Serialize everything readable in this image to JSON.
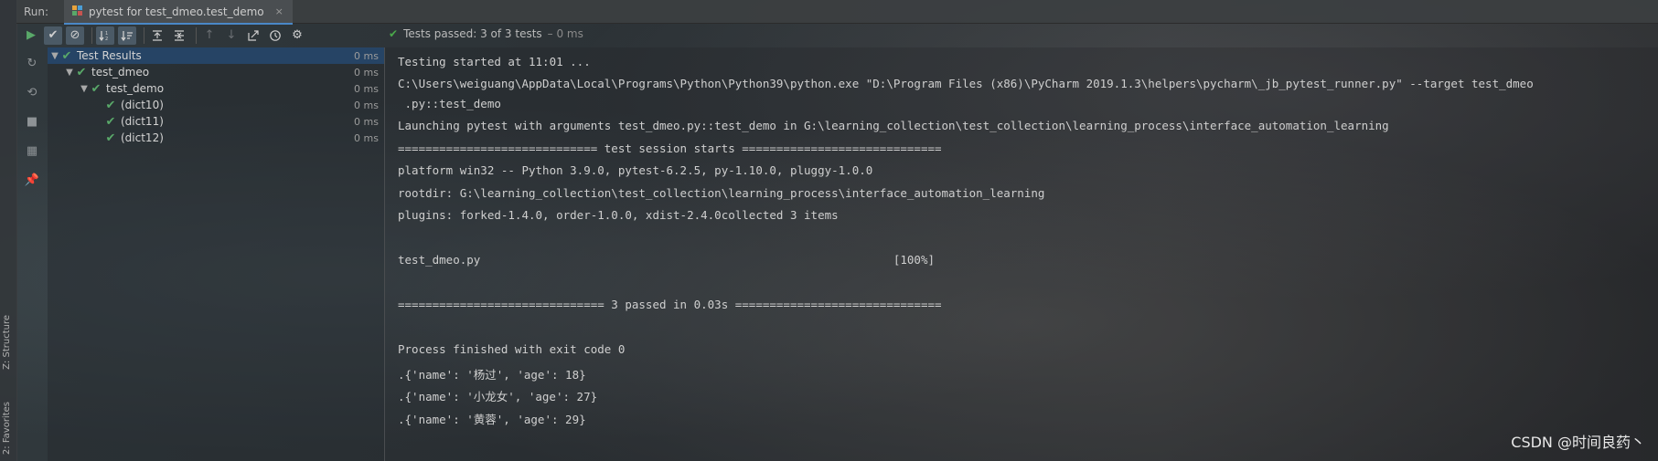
{
  "run_header": {
    "label": "Run:",
    "tab_title": "pytest for test_dmeo.test_demo",
    "tab_close": "×"
  },
  "status": {
    "text": "Tests passed: 3 of 3 tests",
    "duration": "– 0 ms"
  },
  "side_strip": {
    "structure_label": "Z: Structure",
    "favorites_label": "2: Favorites"
  },
  "tree": [
    {
      "label": "Test Results",
      "time": "0 ms",
      "level": 0
    },
    {
      "label": "test_dmeo",
      "time": "0 ms",
      "level": 1
    },
    {
      "label": "test_demo",
      "time": "0 ms",
      "level": 2
    },
    {
      "label": "(dict10)",
      "time": "0 ms",
      "level": 3
    },
    {
      "label": "(dict11)",
      "time": "0 ms",
      "level": 3
    },
    {
      "label": "(dict12)",
      "time": "0 ms",
      "level": 3
    }
  ],
  "console_lines": [
    "Testing started at 11:01 ...",
    "C:\\Users\\weiguang\\AppData\\Local\\Programs\\Python\\Python39\\python.exe \"D:\\Program Files (x86)\\PyCharm 2019.1.3\\helpers\\pycharm\\_jb_pytest_runner.py\" --target test_dmeo",
    " .py::test_demo",
    "Launching pytest with arguments test_dmeo.py::test_demo in G:\\learning_collection\\test_collection\\learning_process\\interface_automation_learning",
    "============================= test session starts =============================",
    "platform win32 -- Python 3.9.0, pytest-6.2.5, py-1.10.0, pluggy-1.0.0",
    "rootdir: G:\\learning_collection\\test_collection\\learning_process\\interface_automation_learning",
    "plugins: forked-1.4.0, order-1.0.0, xdist-2.4.0collected 3 items",
    "",
    "test_dmeo.py                                                            [100%]",
    "",
    "============================== 3 passed in 0.03s ==============================",
    "",
    "Process finished with exit code 0",
    ".{'name': '杨过', 'age': 18}",
    ".{'name': '小龙女', 'age': 27}",
    ".{'name': '黄蓉', 'age': 29}"
  ],
  "watermark": "CSDN @时间良药丶"
}
